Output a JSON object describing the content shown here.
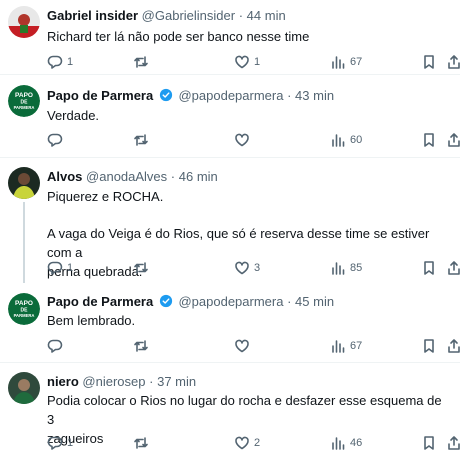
{
  "tweets": [
    {
      "name": "Gabriel insider",
      "handle": "@Gabrielinsider",
      "sep": "·",
      "time": "44 min",
      "verified": false,
      "text": "Richard ter lá não pode ser banco nesse time",
      "replies": "1",
      "retweets": "",
      "likes": "1",
      "views": "67"
    },
    {
      "name": "Papo de Parmera",
      "handle": "@papodeparmera",
      "sep": "·",
      "time": "43 min",
      "verified": true,
      "text": "Verdade.",
      "replies": "",
      "retweets": "",
      "likes": "",
      "views": "60"
    },
    {
      "name": "Alvos",
      "handle": "@anodaAlves",
      "sep": "·",
      "time": "46 min",
      "verified": false,
      "text_lines": [
        "Piquerez e ROCHA.",
        "",
        "A vaga do Veiga é do Rios, que só é reserva desse time se estiver com a",
        "perna quebrada."
      ],
      "replies": "1",
      "retweets": "",
      "likes": "3",
      "views": "85"
    },
    {
      "name": "Papo de Parmera",
      "handle": "@papodeparmera",
      "sep": "·",
      "time": "45 min",
      "verified": true,
      "text": "Bem lembrado.",
      "replies": "",
      "retweets": "",
      "likes": "",
      "views": "67"
    },
    {
      "name": "niero",
      "handle": "@nierosep",
      "sep": "·",
      "time": "37 min",
      "verified": false,
      "text_lines": [
        "Podia colocar o Rios no lugar do rocha e desfazer esse esquema de 3",
        "zagueiros"
      ],
      "replies": "1",
      "retweets": "",
      "likes": "2",
      "views": "46"
    }
  ],
  "papo_logo": [
    "PAPO",
    "DE",
    "PARMERA"
  ],
  "colors": {
    "accent": "#1d9bf0",
    "palmeiras_green": "#0a6b3a",
    "text": "#0f1419",
    "muted": "#536471",
    "divider": "#eff3f4"
  },
  "icons": [
    "reply-icon",
    "retweet-icon",
    "like-icon",
    "views-icon",
    "bookmark-icon",
    "share-icon",
    "verified-badge-icon"
  ]
}
